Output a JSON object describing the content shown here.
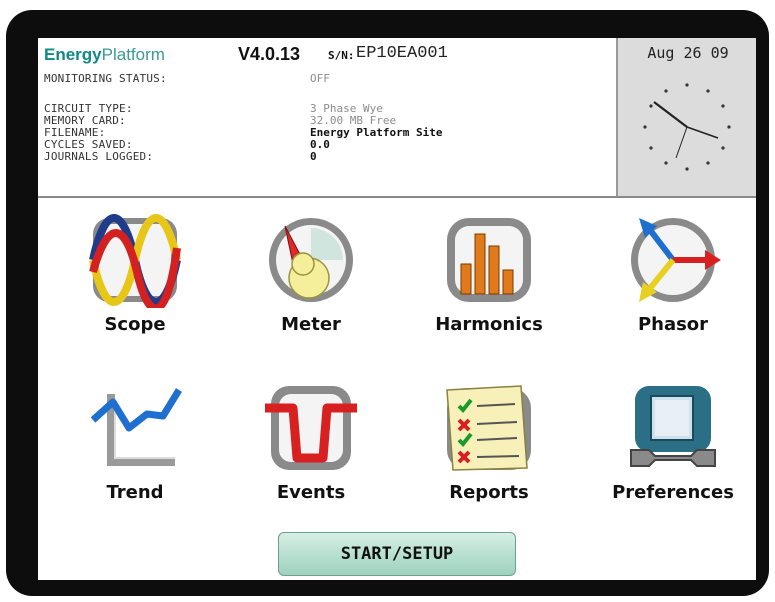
{
  "header": {
    "brand_part1": "Energy",
    "brand_part2": "Platform",
    "version": "V4.0.13",
    "sn_label": "S/N:",
    "serial": "EP10EA001",
    "monitoring_label": "MONITORING STATUS:",
    "monitoring_value": "OFF",
    "circuit_label": "CIRCUIT TYPE:",
    "circuit_value": "3 Phase Wye",
    "memory_label": "MEMORY CARD:",
    "memory_value": "32.00 MB Free",
    "filename_label": "FILENAME:",
    "filename_value": "Energy Platform Site",
    "cycles_label": "CYCLES SAVED:",
    "cycles_value": "0.0",
    "journals_label": "JOURNALS LOGGED:",
    "journals_value": "0"
  },
  "clock": {
    "date": "Aug 26 09"
  },
  "menu": [
    {
      "label": "Scope",
      "icon": "scope-icon"
    },
    {
      "label": "Meter",
      "icon": "meter-icon"
    },
    {
      "label": "Harmonics",
      "icon": "harmonics-icon"
    },
    {
      "label": "Phasor",
      "icon": "phasor-icon"
    },
    {
      "label": "Trend",
      "icon": "trend-icon"
    },
    {
      "label": "Events",
      "icon": "events-icon"
    },
    {
      "label": "Reports",
      "icon": "reports-icon"
    },
    {
      "label": "Preferences",
      "icon": "preferences-icon"
    }
  ],
  "start_button": "START/SETUP",
  "colors": {
    "brand": "#0f8a86",
    "button": "#b8e0d0",
    "clock_bg": "#dcdcdc"
  }
}
